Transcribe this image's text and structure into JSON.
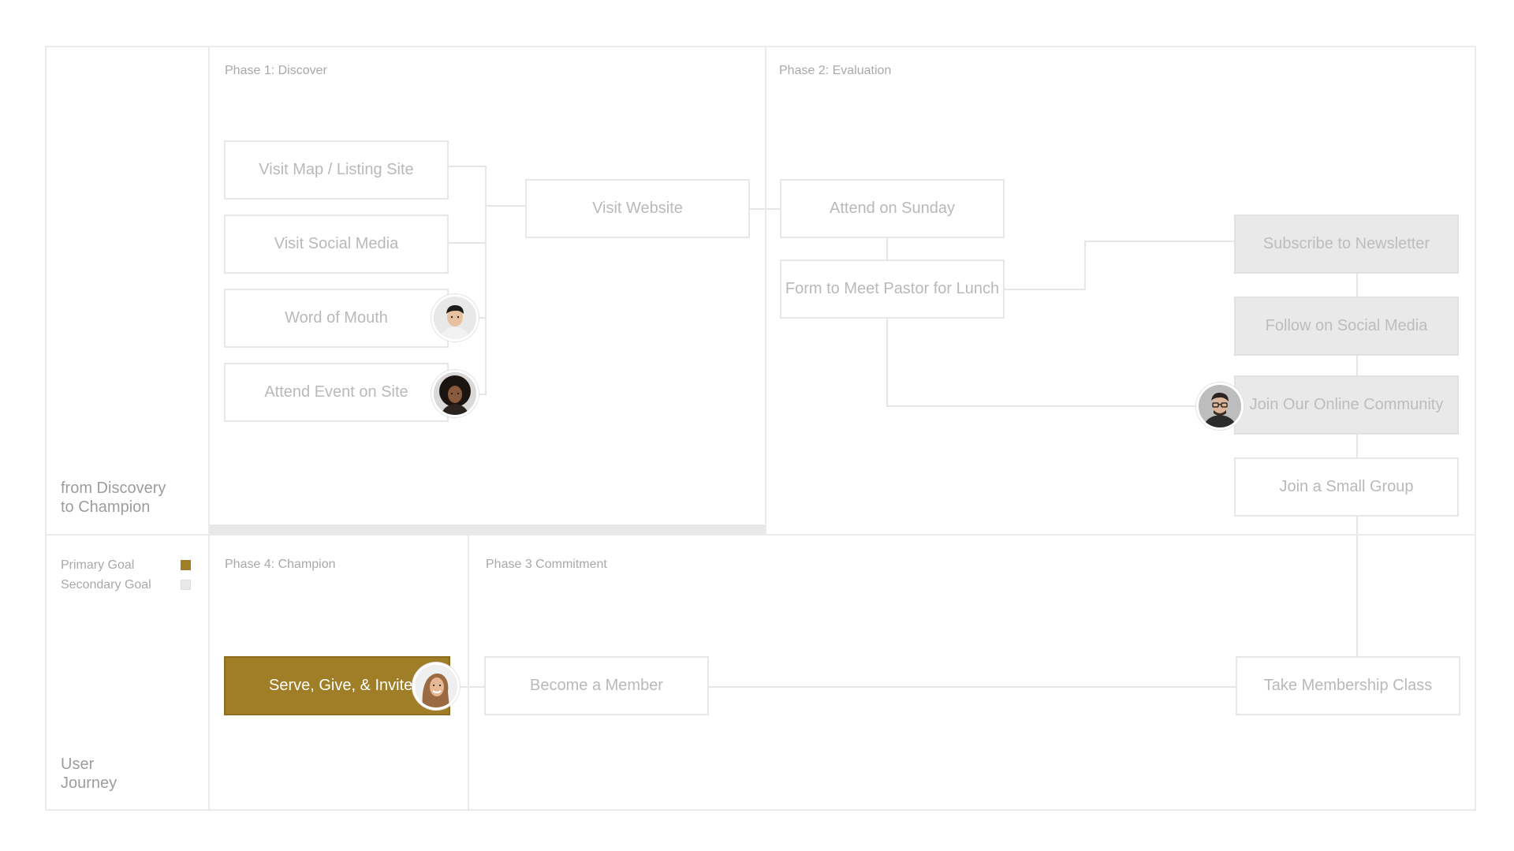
{
  "diagram": {
    "side_title": [
      "from Discovery",
      "to Champion"
    ],
    "side_footer": [
      "User",
      "Journey"
    ],
    "legend": [
      {
        "label": "Primary Goal",
        "color": "#a07d27"
      },
      {
        "label": "Secondary Goal",
        "color": "#e9e9e9"
      }
    ],
    "phases": {
      "discover": "Phase 1: Discover",
      "evaluation": "Phase 2: Evaluation",
      "champion": "Phase 4: Champion",
      "commitment": "Phase 3 Commitment"
    },
    "nodes": {
      "visit_map": "Visit Map / Listing Site",
      "visit_social": "Visit Social Media",
      "word_of_mouth": "Word of Mouth",
      "attend_event": "Attend Event on Site",
      "visit_website": "Visit Website",
      "attend_sunday": "Attend on Sunday",
      "form_pastor": "Form to Meet Pastor for Lunch",
      "subscribe_newsletter": "Subscribe to Newsletter",
      "follow_social": "Follow on Social Media",
      "join_online": "Join Our Online Community",
      "join_small_group": "Join a Small Group",
      "serve_give_invite": "Serve, Give, & Invite",
      "become_member": "Become a Member",
      "membership_class": "Take Membership Class"
    },
    "avatars": [
      "person-avatar-1",
      "person-avatar-2",
      "person-avatar-3",
      "person-avatar-4"
    ]
  }
}
